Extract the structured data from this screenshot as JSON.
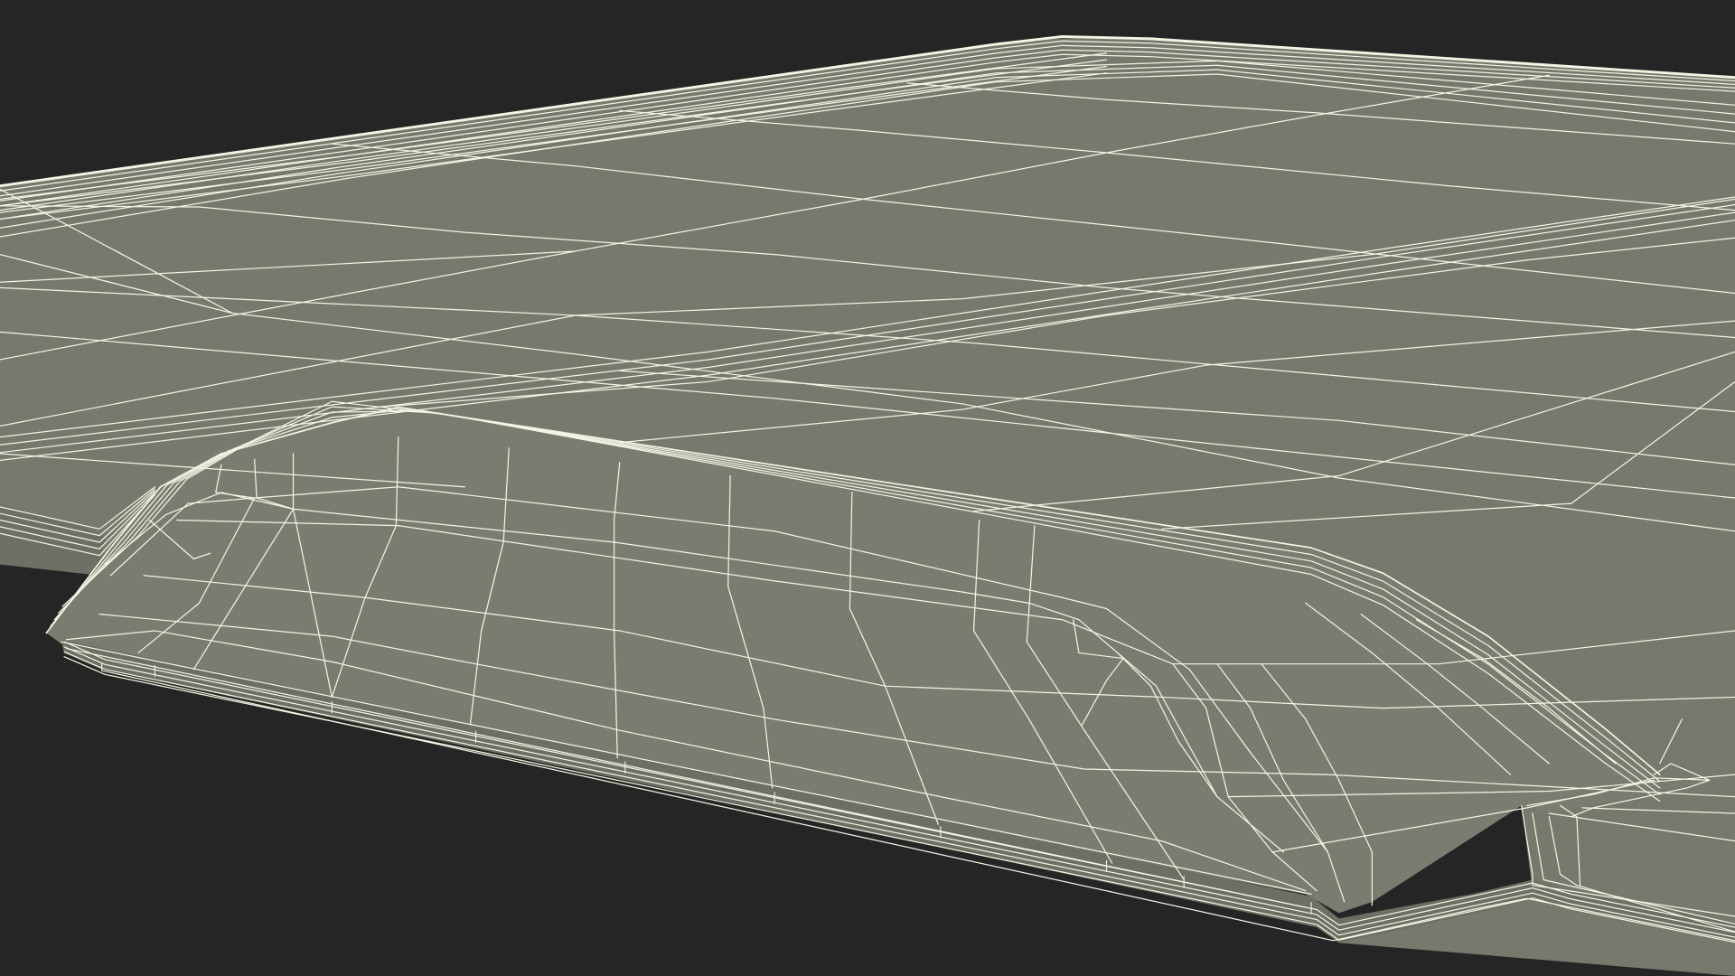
{
  "scene": {
    "background_color": "#252525",
    "surface_color": "#78796d",
    "wire_color": "#f4f4e4",
    "render_style": "wireframe over shaded surface"
  }
}
